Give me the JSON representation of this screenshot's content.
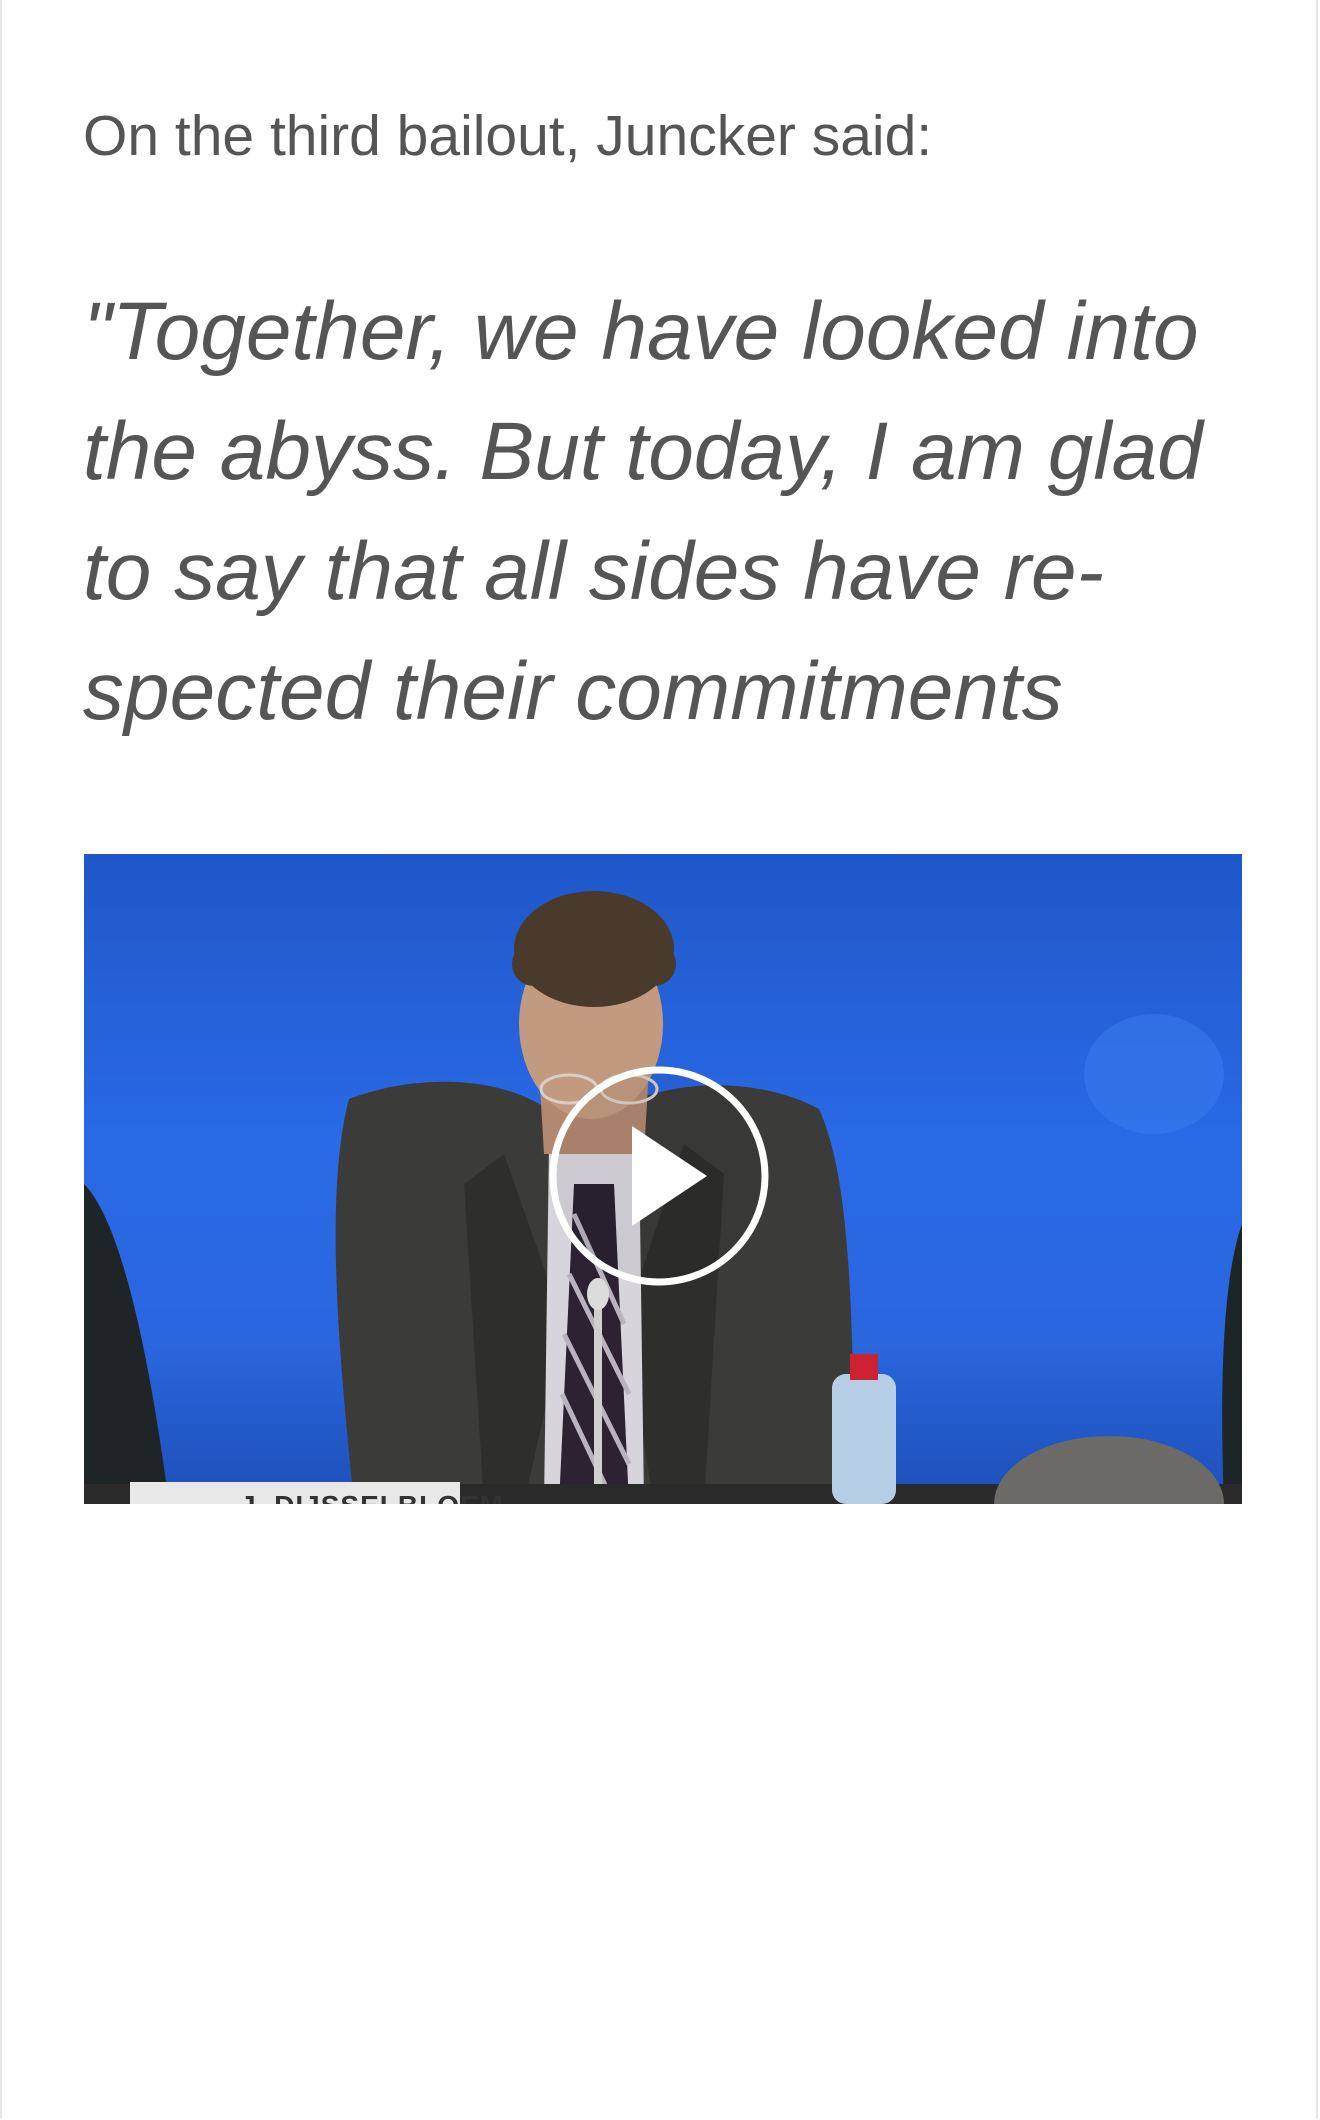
{
  "article": {
    "intro_text": "On the third bailout, Juncker said:",
    "quote_lines": [
      "\"Together, we have looked into",
      "the abyss. But today, I am glad",
      "to say that all sides have re-",
      "spected their commitments"
    ]
  },
  "video": {
    "nameplate_text": "J. DIJSSELBLOEM",
    "play_icon": "play-circle-icon",
    "colors": {
      "background": "#2a66de",
      "play_icon": "#ffffff"
    }
  }
}
